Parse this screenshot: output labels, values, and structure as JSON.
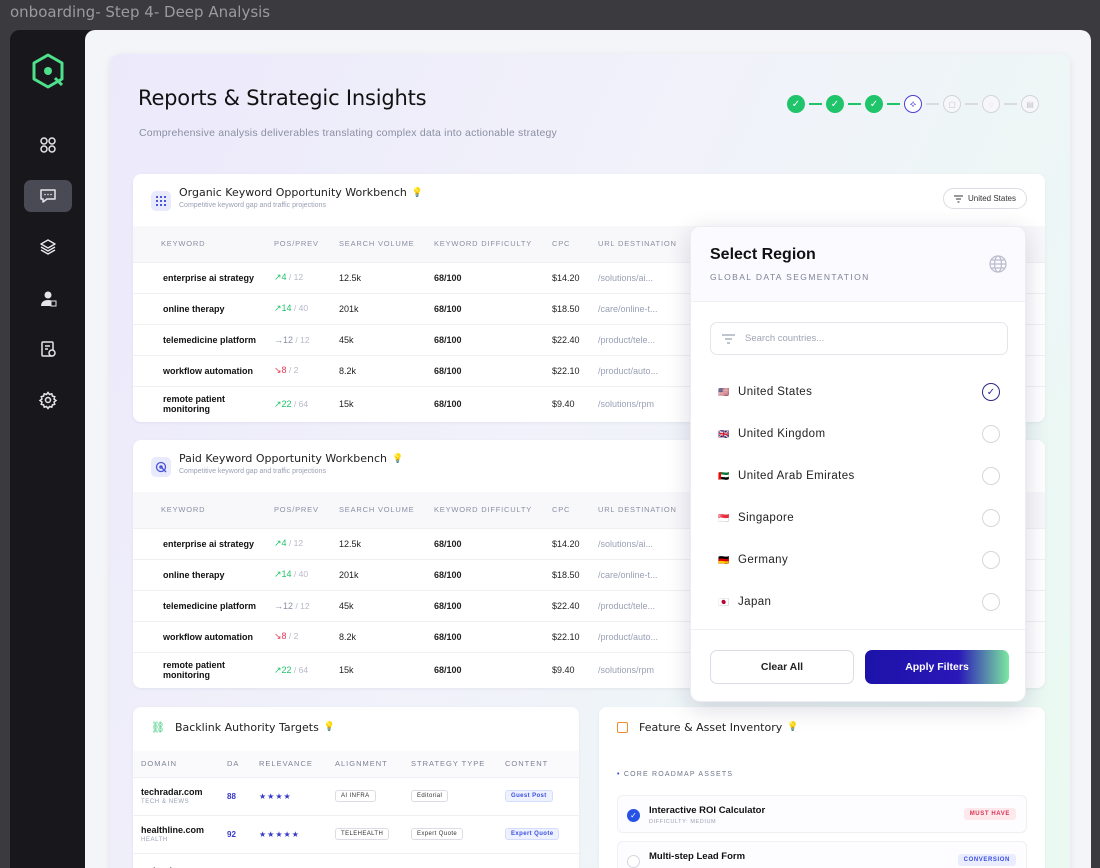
{
  "window": {
    "title": "onboarding- Step 4- Deep Analysis"
  },
  "page": {
    "title": "Reports & Strategic Insights",
    "subtitle": "Comprehensive analysis deliverables translating complex data into actionable strategy"
  },
  "stepper": {
    "completed": 3,
    "current": 4,
    "total": 7
  },
  "organic": {
    "title": "Organic Keyword Opportunity Workbench",
    "subtitle": "Competitive keyword gap and traffic projections",
    "filter_label": "United States",
    "columns": [
      "KEYWORD",
      "POS/PREV",
      "SEARCH VOLUME",
      "KEYWORD DIFFICULTY",
      "CPC",
      "URL DESTINATION"
    ],
    "rows": [
      {
        "keyword": "enterprise ai strategy",
        "pos": "4",
        "prev": "12",
        "trend": "up",
        "volume": "12.5k",
        "difficulty": "68/100",
        "cpc": "$14.20",
        "url": "/solutions/ai..."
      },
      {
        "keyword": "online therapy",
        "pos": "14",
        "prev": "40",
        "trend": "up",
        "volume": "201k",
        "difficulty": "68/100",
        "cpc": "$18.50",
        "url": "/care/online-t..."
      },
      {
        "keyword": "telemedicine platform",
        "pos": "12",
        "prev": "12",
        "trend": "flat",
        "volume": "45k",
        "difficulty": "68/100",
        "cpc": "$22.40",
        "url": "/product/tele..."
      },
      {
        "keyword": "workflow automation",
        "pos": "8",
        "prev": "2",
        "trend": "down",
        "volume": "8.2k",
        "difficulty": "68/100",
        "cpc": "$22.10",
        "url": "/product/auto..."
      },
      {
        "keyword": "remote patient monitoring",
        "pos": "22",
        "prev": "64",
        "trend": "up",
        "volume": "15k",
        "difficulty": "68/100",
        "cpc": "$9.40",
        "url": "/solutions/rpm"
      }
    ]
  },
  "paid": {
    "title": "Paid Keyword Opportunity Workbench",
    "subtitle": "Competitive keyword gap and traffic projections",
    "columns": [
      "KEYWORD",
      "POS/PREV",
      "SEARCH VOLUME",
      "KEYWORD DIFFICULTY",
      "CPC",
      "URL DESTINATION"
    ],
    "rows": [
      {
        "keyword": "enterprise ai strategy",
        "pos": "4",
        "prev": "12",
        "trend": "up",
        "volume": "12.5k",
        "difficulty": "68/100",
        "cpc": "$14.20",
        "url": "/solutions/ai..."
      },
      {
        "keyword": "online therapy",
        "pos": "14",
        "prev": "40",
        "trend": "up",
        "volume": "201k",
        "difficulty": "68/100",
        "cpc": "$18.50",
        "url": "/care/online-t..."
      },
      {
        "keyword": "telemedicine platform",
        "pos": "12",
        "prev": "12",
        "trend": "flat",
        "volume": "45k",
        "difficulty": "68/100",
        "cpc": "$22.40",
        "url": "/product/tele..."
      },
      {
        "keyword": "workflow automation",
        "pos": "8",
        "prev": "2",
        "trend": "down",
        "volume": "8.2k",
        "difficulty": "68/100",
        "cpc": "$22.10",
        "url": "/product/auto..."
      },
      {
        "keyword": "remote patient monitoring",
        "pos": "22",
        "prev": "64",
        "trend": "up",
        "volume": "15k",
        "difficulty": "68/100",
        "cpc": "$9.40",
        "url": "/solutions/rpm"
      }
    ]
  },
  "region": {
    "title": "Select Region",
    "subtitle": "GLOBAL DATA SEGMENTATION",
    "search_placeholder": "Search countries...",
    "countries": [
      {
        "flag": "🇺🇸",
        "name": "United States",
        "selected": true
      },
      {
        "flag": "🇬🇧",
        "name": "United Kingdom",
        "selected": false
      },
      {
        "flag": "🇦🇪",
        "name": "United Arab Emirates",
        "selected": false
      },
      {
        "flag": "🇸🇬",
        "name": "Singapore",
        "selected": false
      },
      {
        "flag": "🇩🇪",
        "name": "Germany",
        "selected": false
      },
      {
        "flag": "🇯🇵",
        "name": "Japan",
        "selected": false
      }
    ],
    "clear_label": "Clear All",
    "apply_label": "Apply Filters"
  },
  "backlinks": {
    "title": "Backlink Authority Targets",
    "columns": [
      "DOMAIN",
      "DA",
      "RELEVANCE",
      "ALIGNMENT",
      "STRATEGY TYPE",
      "CONTENT"
    ],
    "rows": [
      {
        "domain": "techradar.com",
        "category": "TECH & NEWS",
        "da": "88",
        "stars": "★★★★",
        "alignment": "AI INFRA",
        "strategy": "Editorial",
        "content": "Guest Post"
      },
      {
        "domain": "healthline.com",
        "category": "HEALTH",
        "da": "92",
        "stars": "★★★★★",
        "alignment": "TELEHEALTH",
        "strategy": "Expert Quote",
        "content": "Expert Quote"
      },
      {
        "domain": "webmd.com",
        "category": "",
        "da": "",
        "stars": "",
        "alignment": "",
        "strategy": "",
        "content": ""
      }
    ]
  },
  "features": {
    "title": "Feature & Asset Inventory",
    "section_label": "CORE ROADMAP ASSETS",
    "items": [
      {
        "name": "Interactive ROI Calculator",
        "difficulty": "DIFFICULTY: MEDIUM",
        "badge": "MUST HAVE",
        "checked": true
      },
      {
        "name": "Multi-step Lead Form",
        "difficulty": "",
        "badge": "CONVERSION",
        "checked": false
      }
    ]
  },
  "colors": {
    "accent": "#20c46a",
    "primary": "#1c12a8",
    "link": "#3737c8"
  },
  "icons": [
    "logo-icon",
    "dashboard-icon",
    "chat-icon",
    "layers-icon",
    "user-support-icon",
    "report-icon",
    "settings-icon",
    "globe-icon",
    "filter-icon",
    "bulb-icon",
    "link-icon",
    "box-icon"
  ]
}
